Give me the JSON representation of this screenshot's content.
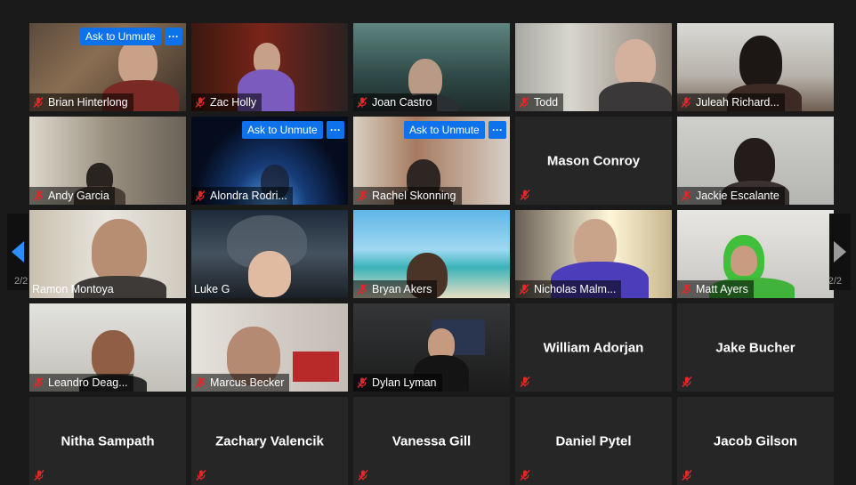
{
  "ask_to_unmute_label": "Ask to Unmute",
  "more_label": "···",
  "pager": {
    "left": "2/2",
    "right": "2/2"
  },
  "colors": {
    "background": "#1a1a1a",
    "tile": "#262626",
    "accent": "#0e72ed",
    "mute": "#e02828"
  },
  "participants": [
    {
      "name": "Brian Hinterlong",
      "video": true,
      "muted": true,
      "ask_unmute": true
    },
    {
      "name": "Zac Holly",
      "video": true,
      "muted": true
    },
    {
      "name": "Joan Castro",
      "video": true,
      "muted": true
    },
    {
      "name": "Todd",
      "video": true,
      "muted": true
    },
    {
      "name": "Juleah Richard...",
      "video": true,
      "muted": true
    },
    {
      "name": "Andy Garcia",
      "video": true,
      "muted": true
    },
    {
      "name": "Alondra Rodri...",
      "video": true,
      "muted": true,
      "ask_unmute": true
    },
    {
      "name": "Rachel Skonning",
      "video": true,
      "muted": true,
      "ask_unmute": true
    },
    {
      "name": "Mason Conroy",
      "video": false,
      "muted": true
    },
    {
      "name": "Jackie Escalante",
      "video": true,
      "muted": true
    },
    {
      "name": "Ramon Montoya",
      "video": true,
      "muted": false
    },
    {
      "name": "Luke G",
      "video": true,
      "muted": false
    },
    {
      "name": "Bryan Akers",
      "video": true,
      "muted": true
    },
    {
      "name": "Nicholas Malm...",
      "video": true,
      "muted": true
    },
    {
      "name": "Matt Ayers",
      "video": true,
      "muted": true
    },
    {
      "name": "Leandro Deag...",
      "video": true,
      "muted": true
    },
    {
      "name": "Marcus Becker",
      "video": true,
      "muted": true
    },
    {
      "name": "Dylan Lyman",
      "video": true,
      "muted": true
    },
    {
      "name": "William Adorjan",
      "video": false,
      "muted": true
    },
    {
      "name": "Jake Bucher",
      "video": false,
      "muted": true
    },
    {
      "name": "Nitha Sampath",
      "video": false,
      "muted": true
    },
    {
      "name": "Zachary Valencik",
      "video": false,
      "muted": true
    },
    {
      "name": "Vanessa Gill",
      "video": false,
      "muted": true
    },
    {
      "name": "Daniel Pytel",
      "video": false,
      "muted": true
    },
    {
      "name": "Jacob Gilson",
      "video": false,
      "muted": true
    }
  ]
}
